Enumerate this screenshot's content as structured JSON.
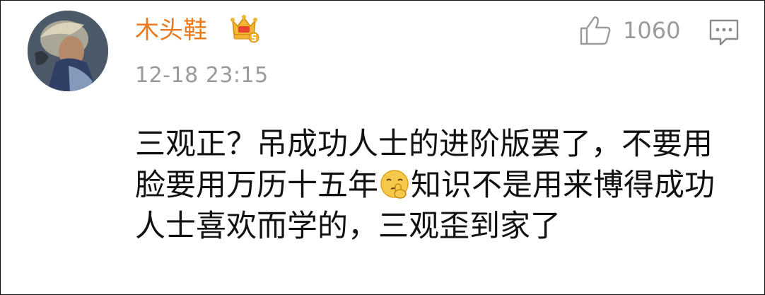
{
  "comment": {
    "username": "木头鞋",
    "timestamp": "12-18 23:15",
    "like_count": "1060",
    "text_before_emoji": "三观正？吊成功人士的进阶版罢了，不要用脸要用万历十五年",
    "text_after_emoji": "知识不是用来博得成功人士喜欢而学的，三观歪到家了"
  },
  "icons": {
    "avatar": "user-avatar",
    "vip_badge": "crown-badge-icon",
    "like": "thumbs-up-icon",
    "comment": "comment-bubble-icon",
    "emoji": "shush-face-emoji"
  },
  "colors": {
    "username": "#ea7a1d",
    "meta_gray": "#9a9a9a",
    "text": "#111111",
    "badge_gold": "#f2b632",
    "badge_red": "#e8432f"
  }
}
